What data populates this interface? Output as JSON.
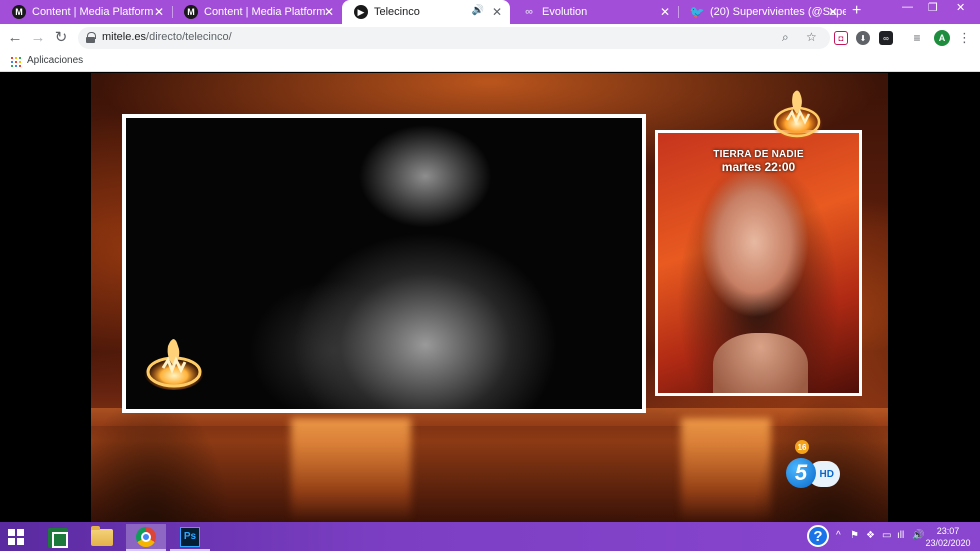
{
  "browser": {
    "tabs": [
      {
        "title": "Content | Media Platform",
        "favicon": "M",
        "icon": "media-platform-icon"
      },
      {
        "title": "Content | Media Platform",
        "favicon": "M",
        "icon": "media-platform-icon"
      },
      {
        "title": "Telecinco",
        "favicon": "▶",
        "icon": "telecinco-icon",
        "active": true,
        "audio": "speaker-icon"
      },
      {
        "title": "Evolution",
        "favicon": "∞",
        "icon": "evolution-icon"
      },
      {
        "title": "(20) Supervivientes (@Supervivi",
        "favicon": "🐦",
        "icon": "twitter-icon"
      }
    ],
    "new_tab": "+",
    "window_controls": {
      "minimize": "—",
      "restore": "❐",
      "close": "✕"
    },
    "address": {
      "host": "mitele.es",
      "path": "/directo/telecinco/"
    },
    "nav": {
      "back": "←",
      "forward": "→",
      "reload": "↻"
    },
    "bookmarks": {
      "apps_label": "Aplicaciones"
    }
  },
  "video": {
    "promo_line1": "TIERRA DE NADIE",
    "promo_line2": "martes 22:00",
    "age_rating": "16",
    "channel_number": "5",
    "channel_hd": "HD"
  },
  "taskbar": {
    "help": "?",
    "ps_label": "Ps",
    "time": "23:07",
    "date": "23/02/2020"
  },
  "colors": {
    "tab_strip": "#a24ed8",
    "taskbar": "#7c3fc4",
    "accent_orange": "#f3a21a",
    "channel_blue": "#0a67c9"
  }
}
